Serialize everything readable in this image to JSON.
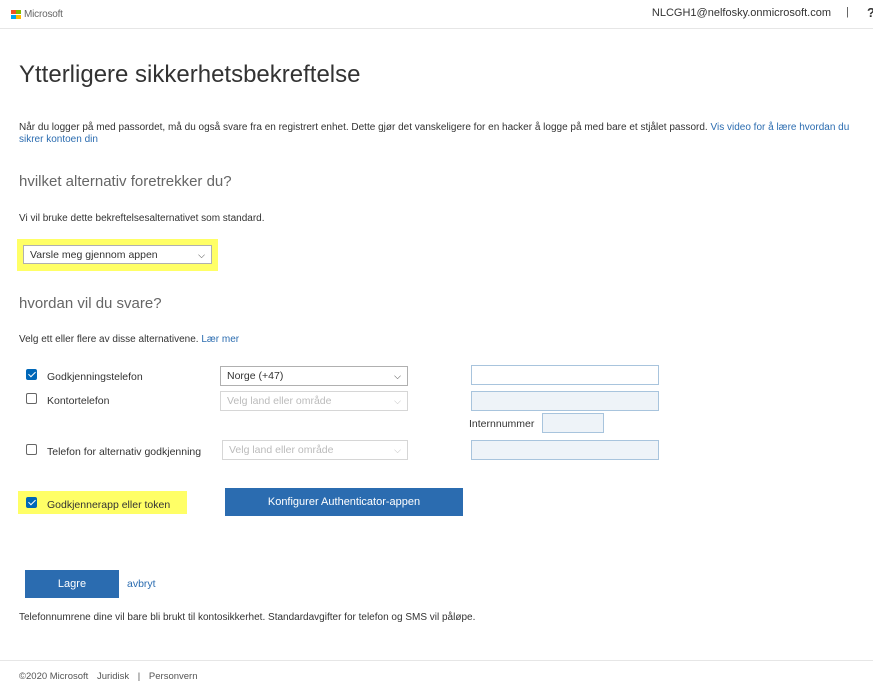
{
  "header": {
    "logo_text": "Microsoft",
    "account": "NLCGH1@nelfosky.onmicrosoft.com",
    "separator": "|",
    "help_glyph": "?"
  },
  "colors": {
    "accent": "#2b6cb0",
    "highlight": "#ffff66",
    "logo_red": "#f25022",
    "logo_green": "#7fba00",
    "logo_blue": "#00a4ef",
    "logo_yellow": "#ffb900"
  },
  "page": {
    "title": "Ytterligere sikkerhetsbekreftelse",
    "intro_text": "Når du logger på med passordet, må du også svare fra en registrert enhet. Dette gjør det vanskeligere for en hacker å logge på med bare et stjålet passord.",
    "intro_link": "Vis video for å lære hvordan du sikrer kontoen din"
  },
  "preference": {
    "heading": "hvilket alternativ foretrekker du?",
    "note": "Vi vil bruke dette bekreftelsesalternativet som standard.",
    "selected": "Varsle meg gjennom appen"
  },
  "response": {
    "heading": "hvordan vil du svare?",
    "note": "Velg ett eller flere av disse alternativene.",
    "note_link": "Lær mer",
    "options": [
      {
        "label": "Godkjenningstelefon",
        "checked": true,
        "country": "Norge (+47)"
      },
      {
        "label": "Kontortelefon",
        "checked": false,
        "country": "Velg land eller område",
        "extension_label": "Internnummer"
      },
      {
        "label": "Telefon for alternativ godkjenning",
        "checked": false,
        "country": "Velg land eller område"
      }
    ],
    "app_option": {
      "label": "Godkjennerapp eller token",
      "checked": true
    },
    "configure_button": "Konfigurer Authenticator-appen"
  },
  "actions": {
    "save": "Lagre",
    "cancel": "avbryt",
    "disclaimer": "Telefonnumrene dine vil bare bli brukt til kontosikkerhet. Standardavgifter for telefon og SMS vil påløpe."
  },
  "footer": {
    "copyright": "©2020 Microsoft",
    "legal": "Juridisk",
    "divider": "|",
    "privacy": "Personvern"
  }
}
